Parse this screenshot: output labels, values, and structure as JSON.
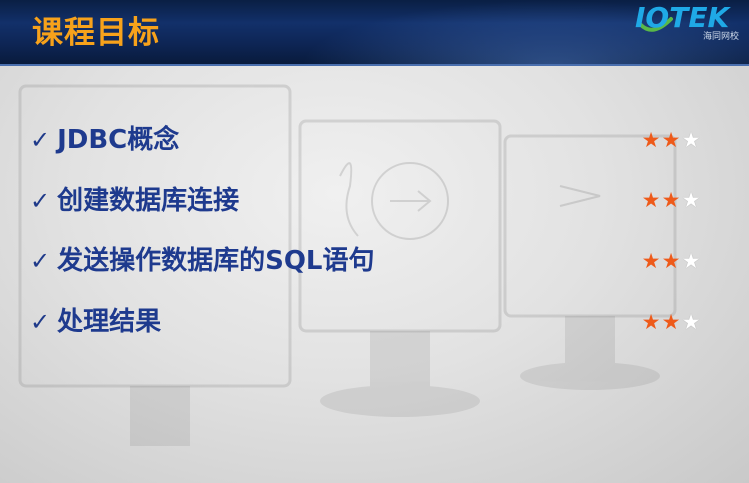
{
  "slide": {
    "title": "课程目标",
    "logo": {
      "brand": "IOTEK",
      "subtitle": "海同网校",
      "color": "#1fa9e6"
    },
    "title_color": "#f7a21b",
    "items": [
      {
        "check": "✓",
        "text": "JDBC概念",
        "stars": "★★☆",
        "rating": 2,
        "max_rating": 3
      },
      {
        "check": "✓",
        "text": "创建数据库连接",
        "stars": "★★☆",
        "rating": 2,
        "max_rating": 3
      },
      {
        "check": "✓",
        "text": "发送操作数据库的SQL语句",
        "stars": "★★☆",
        "rating": 2,
        "max_rating": 3
      },
      {
        "check": "✓",
        "text": "处理结果",
        "stars": "★★☆",
        "rating": 2,
        "max_rating": 3
      }
    ],
    "star_colors": {
      "full": "#ee5a1a",
      "empty": "#ffffff"
    }
  }
}
